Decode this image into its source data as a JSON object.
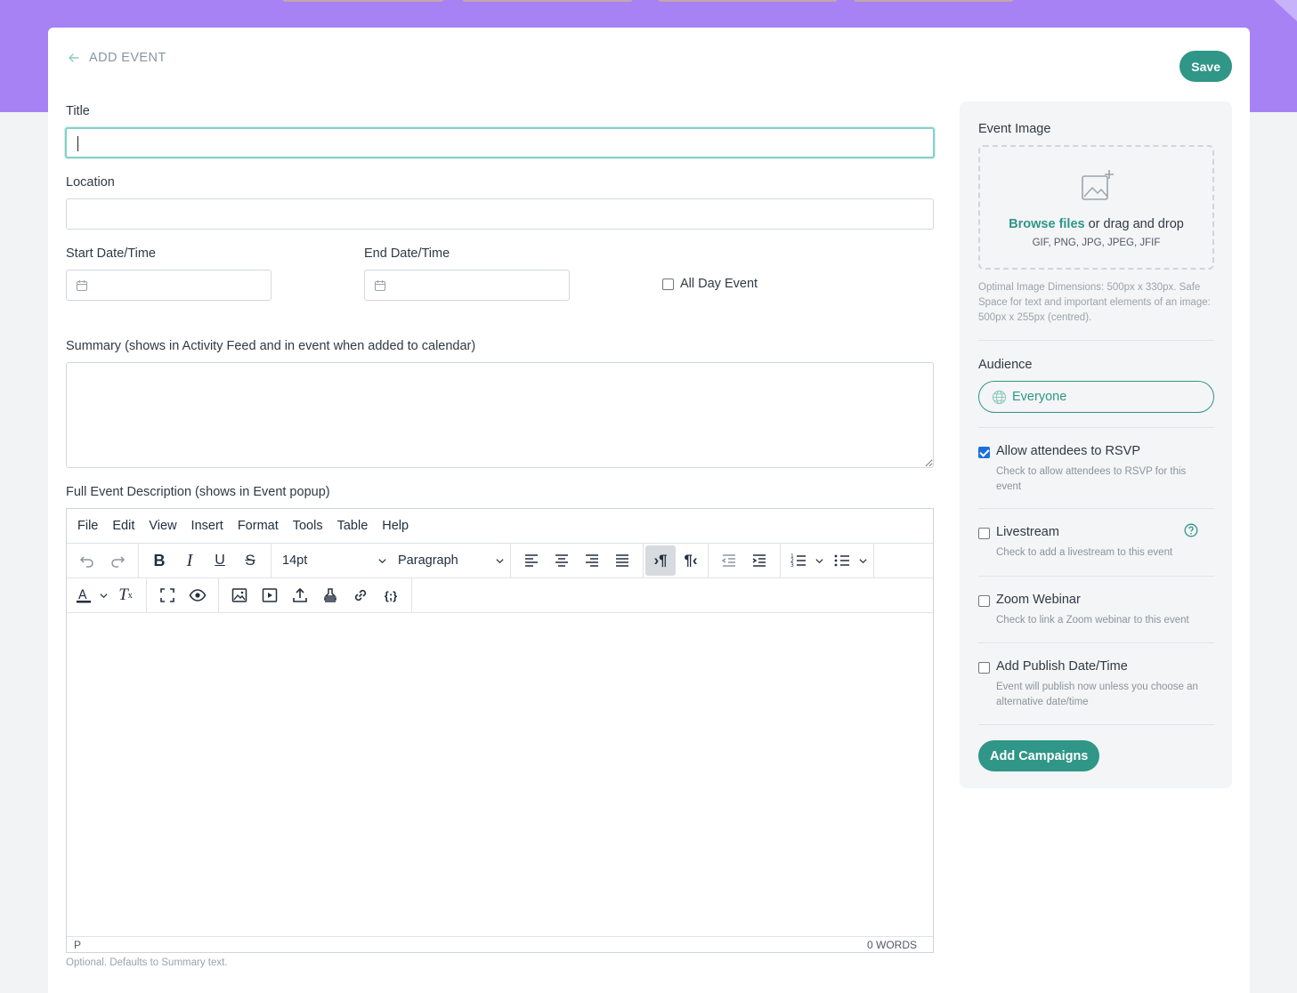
{
  "header": {
    "back_label": "ADD EVENT",
    "save_label": "Save"
  },
  "form": {
    "title_label": "Title",
    "title_value": "",
    "location_label": "Location",
    "location_value": "",
    "start_label": "Start Date/Time",
    "end_label": "End Date/Time",
    "all_day_label": "All Day Event",
    "summary_label": "Summary (shows in Activity Feed and in event when added to calendar)",
    "description_label": "Full Event Description (shows in Event popup)",
    "description_hint": "Optional. Defaults to Summary text."
  },
  "editor": {
    "menu": [
      "File",
      "Edit",
      "View",
      "Insert",
      "Format",
      "Tools",
      "Table",
      "Help"
    ],
    "font_size": "14pt",
    "block_format": "Paragraph",
    "status_path": "P",
    "word_count": "0 WORDS"
  },
  "sidebar": {
    "image_label": "Event Image",
    "browse_link": "Browse files",
    "drop_text": " or drag and drop",
    "file_types": "GIF, PNG, JPG, JPEG, JFIF",
    "dimensions_hint": "Optimal Image Dimensions: 500px x 330px. Safe Space for text and important elements of an image: 500px x 255px (centred).",
    "audience_label": "Audience",
    "audience_value": "Everyone",
    "options": [
      {
        "label": "Allow attendees to RSVP",
        "desc": "Check to allow attendees to RSVP for this event",
        "checked": true
      },
      {
        "label": "Livestream",
        "desc": "Check to add a livestream to this event",
        "checked": false
      },
      {
        "label": "Zoom Webinar",
        "desc": "Check to link a Zoom webinar to this event",
        "checked": false
      },
      {
        "label": "Add Publish Date/Time",
        "desc": "Event will publish now unless you choose an alternative date/time",
        "checked": false
      }
    ],
    "campaigns_label": "Add Campaigns"
  },
  "colors": {
    "accent": "#2f9688",
    "banner": "#a682f5",
    "checkbox": "#1a6fe0"
  }
}
